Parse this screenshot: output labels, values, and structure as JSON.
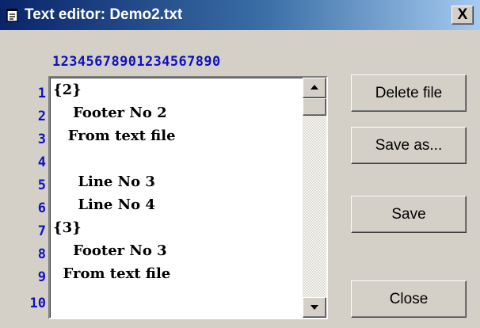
{
  "window": {
    "title": "Text editor: Demo2.txt",
    "close_label": "X"
  },
  "editor": {
    "column_ruler": "12345678901234567890",
    "line_numbers": [
      "1",
      "2",
      "3",
      "4",
      "5",
      "6",
      "7",
      "8",
      "9",
      "10"
    ],
    "lines": [
      "{2}",
      "    Footer No 2",
      "   From text file",
      "",
      "     Line No 3",
      "     Line No 4",
      "{3}",
      "    Footer No 3",
      "  From text file"
    ]
  },
  "buttons": {
    "delete_file": "Delete file",
    "save_as": "Save as...",
    "save": "Save",
    "close": "Close"
  },
  "colors": {
    "title_gradient_start": "#0a246a",
    "title_gradient_end": "#a6caf0",
    "face": "#d4d0c8",
    "line_number_color": "#1010c0"
  },
  "icons": {
    "title": "notepad-icon",
    "scroll_up": "arrow-up-icon",
    "scroll_down": "arrow-down-icon"
  }
}
